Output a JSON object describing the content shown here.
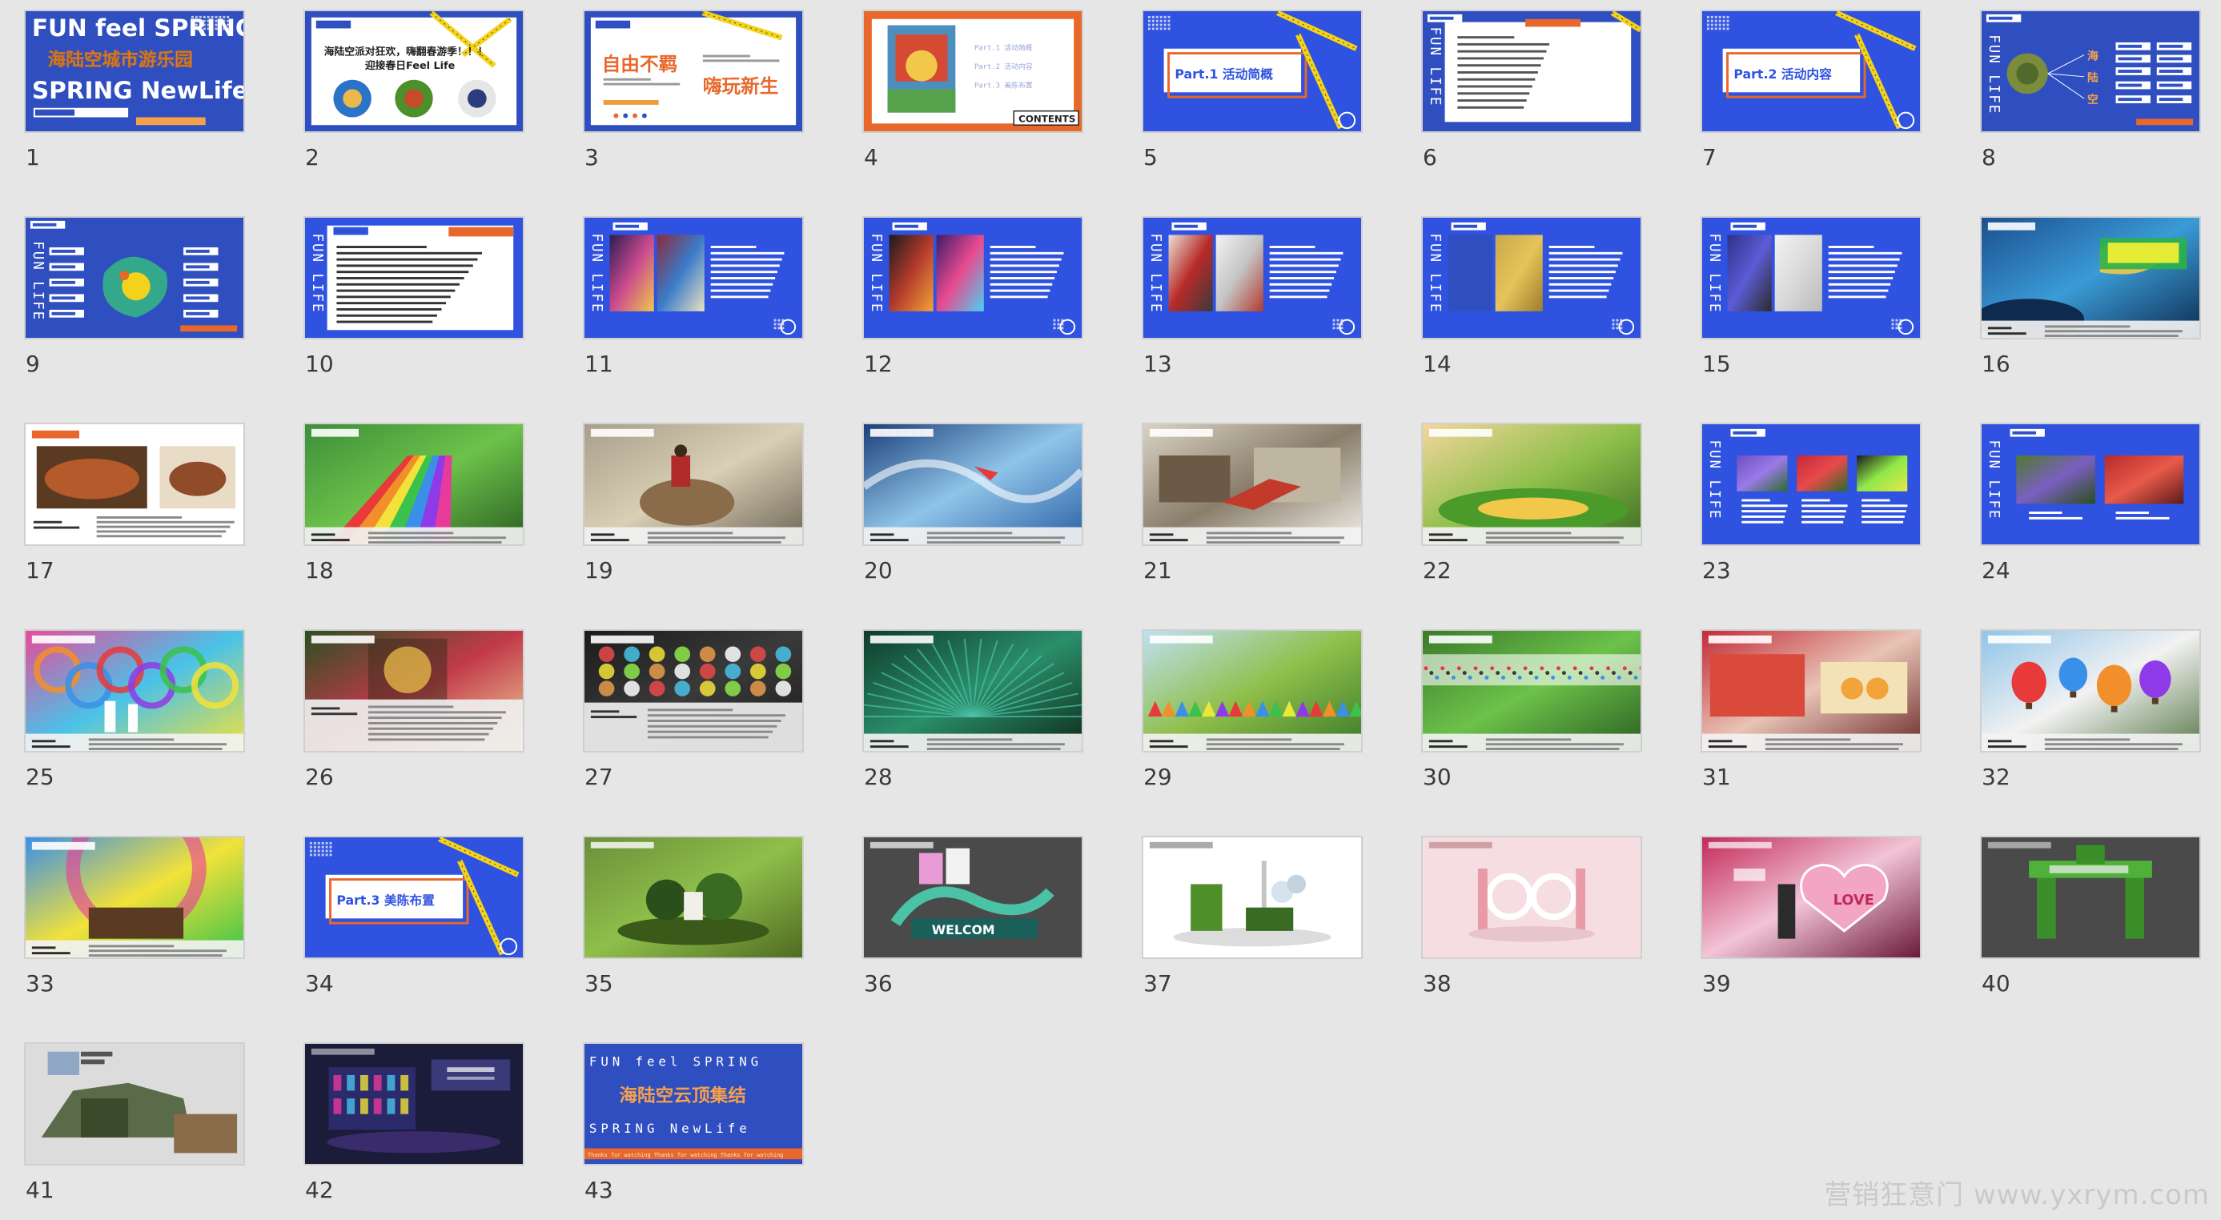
{
  "watermark": "营销狂意门 www.yxrym.com",
  "texts": {
    "s1_line1": "FUN feel SPRING",
    "s1_line2": "海陆空城市游乐园",
    "s1_line3": "SPRING NewLife",
    "s2_line1": "海陆空派对狂欢，嗨翻春游季！！！",
    "s2_line2": "迎接春日Feel Life",
    "s3_left": "自由不羁",
    "s3_right": "嗨玩新生",
    "s4_item1": "Part.1 活动简概",
    "s4_item2": "Part.2 活动内容",
    "s4_item3": "Part.3 美陈布置",
    "s4_contents": "CONTENTS",
    "s5_title": "Part.1 活动简概",
    "s7_title": "Part.2 活动内容",
    "s8_hai": "海",
    "s8_lu": "陆",
    "s8_kong": "空",
    "fun_life": "FUN LIFE",
    "s34_title": "Part.3 美陈布置",
    "s36_welcome": "WELCOM",
    "s39_love": "LOVE",
    "s43_line1": "FUN feel SPRING",
    "s43_line2": "海陆空云顶集结",
    "s43_line3": "SPRING NewLife",
    "s43_line4": "Thanks for watching Thanks for watching Thanks for watching"
  },
  "slides": [
    {
      "number": "1",
      "kind": "title"
    },
    {
      "number": "2",
      "kind": "intro"
    },
    {
      "number": "3",
      "kind": "slogan"
    },
    {
      "number": "4",
      "kind": "contents"
    },
    {
      "number": "5",
      "kind": "part1"
    },
    {
      "number": "6",
      "kind": "text"
    },
    {
      "number": "7",
      "kind": "part2"
    },
    {
      "number": "8",
      "kind": "mindmap"
    },
    {
      "number": "9",
      "kind": "map"
    },
    {
      "number": "10",
      "kind": "schedule"
    },
    {
      "number": "11",
      "kind": "blue-photo"
    },
    {
      "number": "12",
      "kind": "blue-photo"
    },
    {
      "number": "13",
      "kind": "blue-photo"
    },
    {
      "number": "14",
      "kind": "blue-photo"
    },
    {
      "number": "15",
      "kind": "blue-photo"
    },
    {
      "number": "16",
      "kind": "photo-aquarium"
    },
    {
      "number": "17",
      "kind": "photo-food"
    },
    {
      "number": "18",
      "kind": "photo-slide"
    },
    {
      "number": "19",
      "kind": "photo-camel"
    },
    {
      "number": "20",
      "kind": "photo-wind"
    },
    {
      "number": "21",
      "kind": "photo-indoor"
    },
    {
      "number": "22",
      "kind": "photo-garden"
    },
    {
      "number": "23",
      "kind": "blue-flowers"
    },
    {
      "number": "24",
      "kind": "blue-flowers2"
    },
    {
      "number": "25",
      "kind": "photo-windmill"
    },
    {
      "number": "26",
      "kind": "photo-flower-wall"
    },
    {
      "number": "27",
      "kind": "photo-hex"
    },
    {
      "number": "28",
      "kind": "photo-peacock"
    },
    {
      "number": "29",
      "kind": "photo-tents"
    },
    {
      "number": "30",
      "kind": "photo-crowd"
    },
    {
      "number": "31",
      "kind": "photo-market"
    },
    {
      "number": "32",
      "kind": "photo-balloons"
    },
    {
      "number": "33",
      "kind": "photo-balloon-close"
    },
    {
      "number": "34",
      "kind": "part3"
    },
    {
      "number": "35",
      "kind": "render-green"
    },
    {
      "number": "36",
      "kind": "render-welcome"
    },
    {
      "number": "37",
      "kind": "render-white"
    },
    {
      "number": "38",
      "kind": "render-pink"
    },
    {
      "number": "39",
      "kind": "render-love"
    },
    {
      "number": "40",
      "kind": "render-gate"
    },
    {
      "number": "41",
      "kind": "render-ruins"
    },
    {
      "number": "42",
      "kind": "render-stage"
    },
    {
      "number": "43",
      "kind": "end"
    }
  ]
}
